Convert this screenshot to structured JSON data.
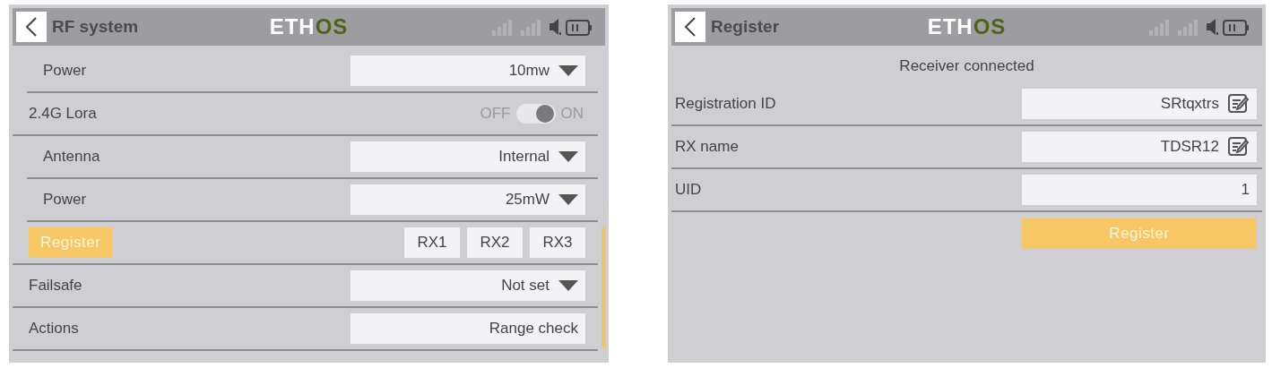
{
  "screens": [
    {
      "title": "RF system",
      "logo": {
        "part_1": "ETH",
        "part_2": "OS"
      },
      "items": [
        {
          "kind": "group",
          "children": [
            {
              "kind": "dropdown",
              "label": "Power",
              "value": "10mw"
            }
          ]
        },
        {
          "kind": "toggle",
          "label": "2.4G Lora",
          "off_label": "OFF",
          "on_label": "ON",
          "on": true,
          "children": [
            {
              "kind": "dropdown",
              "label": "Antenna",
              "value": "Internal"
            },
            {
              "kind": "dropdown",
              "label": "Power",
              "value": "25mW"
            }
          ]
        },
        {
          "kind": "buttons",
          "button": "Register",
          "options": [
            "RX1",
            "RX2",
            "RX3"
          ]
        },
        {
          "kind": "dropdown",
          "label": "Failsafe",
          "value": "Not set"
        },
        {
          "kind": "action",
          "label": "Actions",
          "value": "Range check"
        }
      ]
    },
    {
      "title": "Register",
      "logo": {
        "part_1": "ETH",
        "part_2": "OS"
      },
      "status": "Receiver connected",
      "items": [
        {
          "kind": "text_field",
          "label": "Registration ID",
          "value": "SRtqxtrs",
          "editable": true
        },
        {
          "kind": "text_field",
          "label": "RX name",
          "value": "TDSR12",
          "editable": true
        },
        {
          "kind": "text_field",
          "label": "UID",
          "value": "1",
          "editable": false
        },
        {
          "kind": "register",
          "value": "Register"
        }
      ]
    }
  ]
}
